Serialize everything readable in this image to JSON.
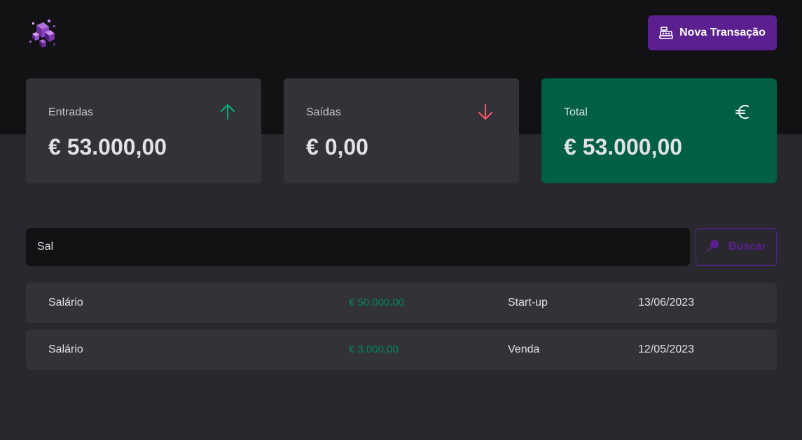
{
  "header": {
    "logo_icon": "cube-cluster-logo",
    "new_transaction_label": "Nova Transação",
    "new_transaction_icon": "cash-register-icon"
  },
  "summary": {
    "income": {
      "label": "Entradas",
      "value": "€ 53.000,00",
      "icon": "arrow-up-icon",
      "icon_color": "#00b37e"
    },
    "outcome": {
      "label": "Saídas",
      "value": "€ 0,00",
      "icon": "arrow-down-icon",
      "icon_color": "#f75a68"
    },
    "total": {
      "label": "Total",
      "value": "€ 53.000,00",
      "icon": "euro-icon",
      "background": "#015f43"
    }
  },
  "search": {
    "value": "Sal",
    "button_label": "Buscar",
    "button_icon": "magnifier-icon",
    "accent": "#5b1f8f"
  },
  "transactions": [
    {
      "description": "Salário",
      "amount": "€ 50.000,00",
      "category": "Start-up",
      "date": "13/06/2023"
    },
    {
      "description": "Salário",
      "amount": "€ 3.000,00",
      "category": "Venda",
      "date": "12/05/2023"
    }
  ]
}
